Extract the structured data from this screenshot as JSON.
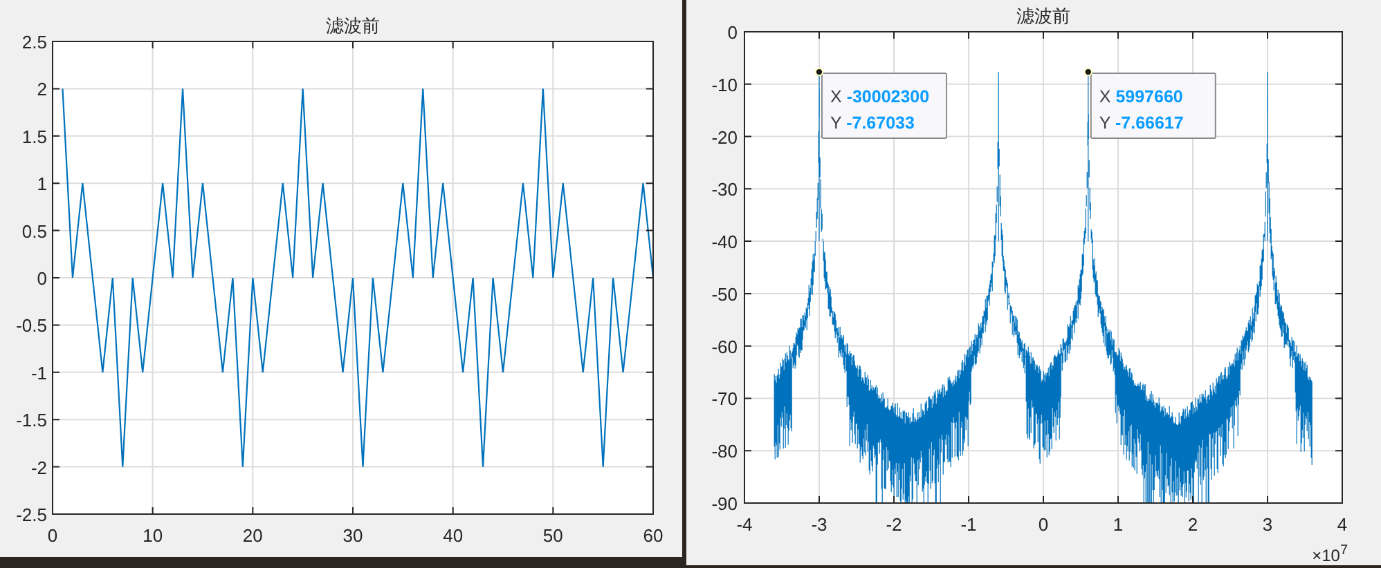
{
  "figures": [
    {
      "chart_data": {
        "type": "line",
        "title": "滤波前",
        "grid": true,
        "x": [
          1,
          2,
          3,
          4,
          5,
          6,
          7,
          8,
          9,
          10,
          11,
          12,
          13,
          14,
          15,
          16,
          17,
          18,
          19,
          20,
          21,
          22,
          23,
          24,
          25,
          26,
          27,
          28,
          29,
          30,
          31,
          32,
          33,
          34,
          35,
          36,
          37,
          38,
          39,
          40,
          41,
          42,
          43,
          44,
          45,
          46,
          47,
          48,
          49,
          50,
          51,
          52,
          53,
          54,
          55,
          56,
          57,
          58,
          59,
          60
        ],
        "series": [
          {
            "color": "#0072bd",
            "values": [
              2,
              0,
              1,
              0,
              -1,
              0,
              -2,
              0,
              -1,
              0,
              1,
              0,
              2,
              0,
              1,
              0,
              -1,
              0,
              -2,
              0,
              -1,
              0,
              1,
              0,
              2,
              0,
              1,
              0,
              -1,
              0,
              -2,
              0,
              -1,
              0,
              1,
              0,
              2,
              0,
              1,
              0,
              -1,
              0,
              -2,
              0,
              -1,
              0,
              1,
              0,
              2,
              0,
              1,
              0,
              -1,
              0,
              -2,
              0,
              -1,
              0,
              1,
              0
            ]
          }
        ],
        "xlim": [
          0,
          60
        ],
        "ylim": [
          -2.5,
          2.5
        ],
        "xticks": [
          0,
          10,
          20,
          30,
          40,
          50,
          60
        ],
        "yticks": [
          -2.5,
          -2,
          -1.5,
          -1,
          -0.5,
          0,
          0.5,
          1,
          1.5,
          2,
          2.5
        ]
      }
    },
    {
      "title": "滤波前",
      "x_tick_labels": [
        "-4",
        "-3",
        "-2",
        "-1",
        "0",
        "1",
        "2",
        "3",
        "4"
      ],
      "y_tick_labels": [
        "0",
        "-10",
        "-20",
        "-30",
        "-40",
        "-50",
        "-60",
        "-70",
        "-80",
        "-90"
      ],
      "x_exponent_label": "×10$^{7}$",
      "data_tips": [
        {
          "x_label": "X",
          "x_value": "-30002300",
          "y_label": "Y",
          "y_value": "-7.67033"
        },
        {
          "x_label": "X",
          "x_value": "5997660",
          "y_label": "Y",
          "y_value": "-7.66617"
        }
      ]
    }
  ]
}
